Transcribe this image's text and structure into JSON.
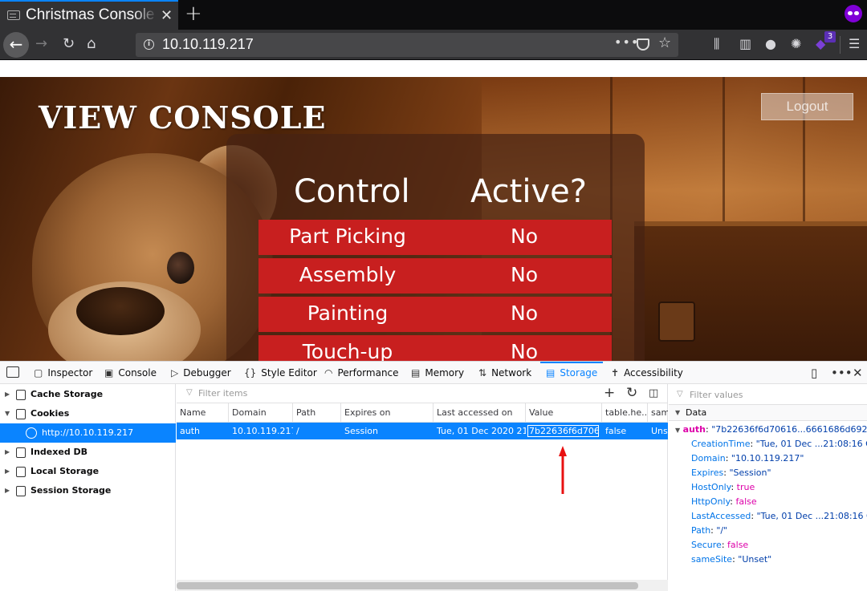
{
  "browser": {
    "tab_title": "Christmas Console",
    "tab_close": "✕",
    "new_tab": "+",
    "url": "10.10.119.217",
    "extension_badge": "3",
    "accent_color": "#0a84ff"
  },
  "page": {
    "title": "VIEW CONSOLE",
    "logout_label": "Logout",
    "headers": {
      "control": "Control",
      "active": "Active?"
    },
    "rows": [
      {
        "name": "Part Picking",
        "value": "No"
      },
      {
        "name": "Assembly",
        "value": "No"
      },
      {
        "name": "Painting",
        "value": "No"
      },
      {
        "name": "Touch-up",
        "value": "No"
      }
    ],
    "row_color": "#c81f1f"
  },
  "devtools": {
    "tabs": [
      "Inspector",
      "Console",
      "Debugger",
      "Style Editor",
      "Performance",
      "Memory",
      "Network",
      "Storage",
      "Accessibility"
    ],
    "active_tab": "Storage",
    "tree": [
      {
        "label": "Cache Storage"
      },
      {
        "label": "Cookies"
      },
      {
        "label": "http://10.10.119.217"
      },
      {
        "label": "Indexed DB"
      },
      {
        "label": "Local Storage"
      },
      {
        "label": "Session Storage"
      }
    ],
    "table": {
      "filter_placeholder": "Filter items",
      "columns": [
        "Name",
        "Domain",
        "Path",
        "Expires on",
        "Last accessed on",
        "Value",
        "table.he...",
        "sam"
      ],
      "row": {
        "name": "auth",
        "domain": "10.10.119.217",
        "path": "/",
        "expires": "Session",
        "last_accessed": "Tue, 01 Dec 2020 21...",
        "value": "7b22636f6d7061",
        "http_only": "false",
        "same_site": "Uns"
      }
    },
    "sidebar": {
      "filter_placeholder": "Filter values",
      "section": "Data",
      "auth_key": "auth",
      "auth_value": "\"7b22636f6d70616...6661686d69227d\"",
      "props": [
        {
          "key": "CreationTime",
          "value": "\"Tue, 01 Dec ...21:08:16 GMT\"",
          "type": "s"
        },
        {
          "key": "Domain",
          "value": "\"10.10.119.217\"",
          "type": "s"
        },
        {
          "key": "Expires",
          "value": "\"Session\"",
          "type": "s"
        },
        {
          "key": "HostOnly",
          "value": "true",
          "type": "b"
        },
        {
          "key": "HttpOnly",
          "value": "false",
          "type": "b"
        },
        {
          "key": "LastAccessed",
          "value": "\"Tue, 01 Dec ...21:08:16 GMT\"",
          "type": "s"
        },
        {
          "key": "Path",
          "value": "\"/\"",
          "type": "s"
        },
        {
          "key": "Secure",
          "value": "false",
          "type": "b"
        },
        {
          "key": "sameSite",
          "value": "\"Unset\"",
          "type": "s"
        }
      ]
    }
  }
}
